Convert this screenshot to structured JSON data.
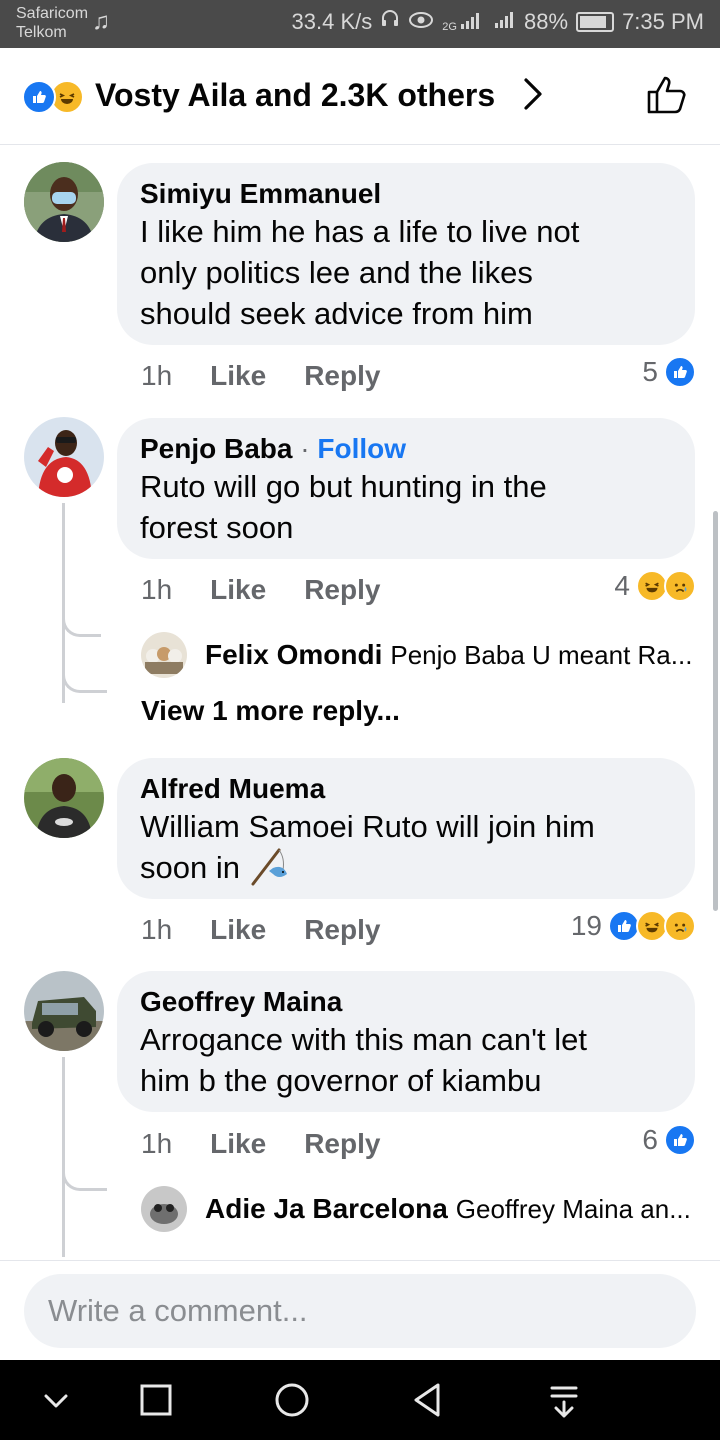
{
  "status_bar": {
    "carrier_1": "Safaricom",
    "carrier_2": "Telkom",
    "speed": "33.4 K/s",
    "network": "2G",
    "battery": "88%",
    "time": "7:35 PM"
  },
  "header": {
    "reactions_text": "Vosty Aila and 2.3K others",
    "reaction_icons": [
      "like-icon",
      "haha-icon"
    ]
  },
  "comments": [
    {
      "author": "Simiyu Emmanuel",
      "text": "I like him he has a life to live not\nonly  politics lee and the likes\nshould seek advice from him",
      "time": "1h",
      "like": "Like",
      "reply": "Reply",
      "reaction_count": "5",
      "reactions": [
        "like"
      ]
    },
    {
      "author": "Penjo Baba",
      "separator": "·",
      "follow": "Follow",
      "text": "Ruto will go but hunting in the\nforest soon",
      "time": "1h",
      "like": "Like",
      "reply": "Reply",
      "reaction_count": "4",
      "reactions": [
        "haha",
        "sad"
      ],
      "reply_preview": {
        "author": "Felix Omondi",
        "text": "Penjo Baba U meant Ra..."
      },
      "view_more": "View 1 more reply..."
    },
    {
      "author": "Alfred Muema",
      "text": "William Samoei Ruto will join him\nsoon in",
      "emoji": "fishing-pole-icon",
      "time": "1h",
      "like": "Like",
      "reply": "Reply",
      "reaction_count": "19",
      "reactions": [
        "like",
        "haha",
        "sad"
      ]
    },
    {
      "author": "Geoffrey Maina",
      "text": "Arrogance with this man can't let\nhim b the governor of kiambu",
      "time": "1h",
      "like": "Like",
      "reply": "Reply",
      "reaction_count": "6",
      "reactions": [
        "like"
      ],
      "reply_preview": {
        "author": "Adie Ja Barcelona",
        "text": "Geoffrey Maina an..."
      }
    }
  ],
  "composer": {
    "placeholder": "Write a comment..."
  },
  "colors": {
    "accent": "#1877f2",
    "bubble": "#f0f2f5",
    "muted": "#65676b"
  }
}
